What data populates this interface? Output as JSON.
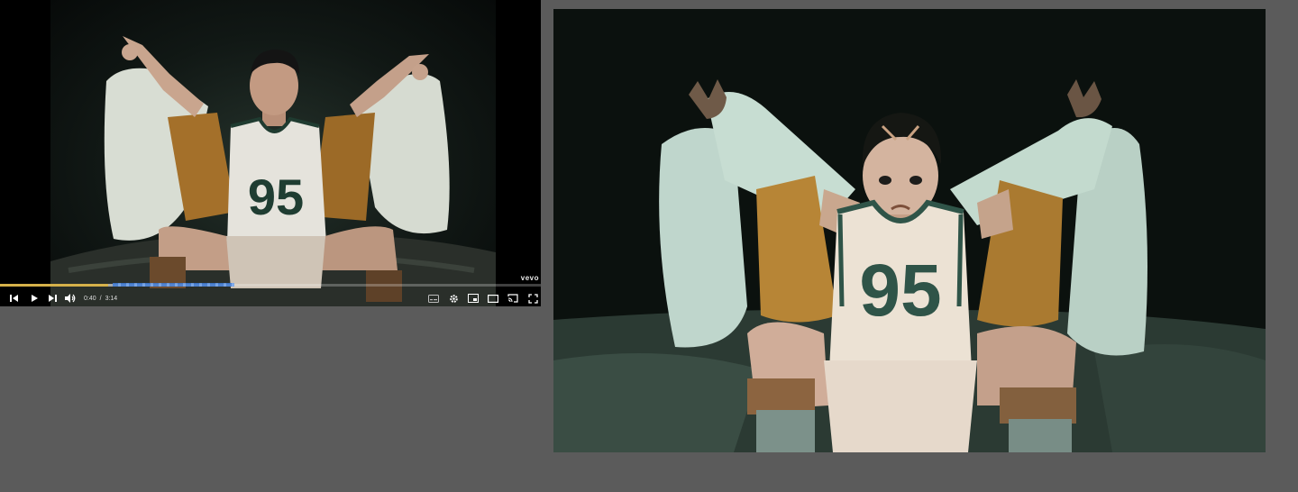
{
  "player": {
    "watermark": "vevo",
    "time": {
      "current": "0:40",
      "separator": "/",
      "duration": "3:14"
    },
    "progress_fraction": 0.2,
    "buffer_fraction": 0.43,
    "colors": {
      "played": "#d6b14a",
      "chapters": "#3f7bd6"
    },
    "photo": {
      "jersey_number": "95"
    },
    "controls": {
      "previous": "previous-icon",
      "play": "play-icon",
      "next": "next-icon",
      "volume": "volume-icon",
      "subtitles": "subtitles-icon",
      "settings": "gear-icon",
      "miniplayer": "miniplayer-icon",
      "theater": "theater-mode-icon",
      "cast": "cast-icon",
      "fullscreen": "fullscreen-icon"
    }
  },
  "painting": {
    "jersey_number": "95",
    "colors": {
      "background": "#0b110e",
      "jacket": "#b78536",
      "fur": "#bfd6cc",
      "jersey": "#ece2d4",
      "jersey_trim": "#2f5448"
    }
  }
}
